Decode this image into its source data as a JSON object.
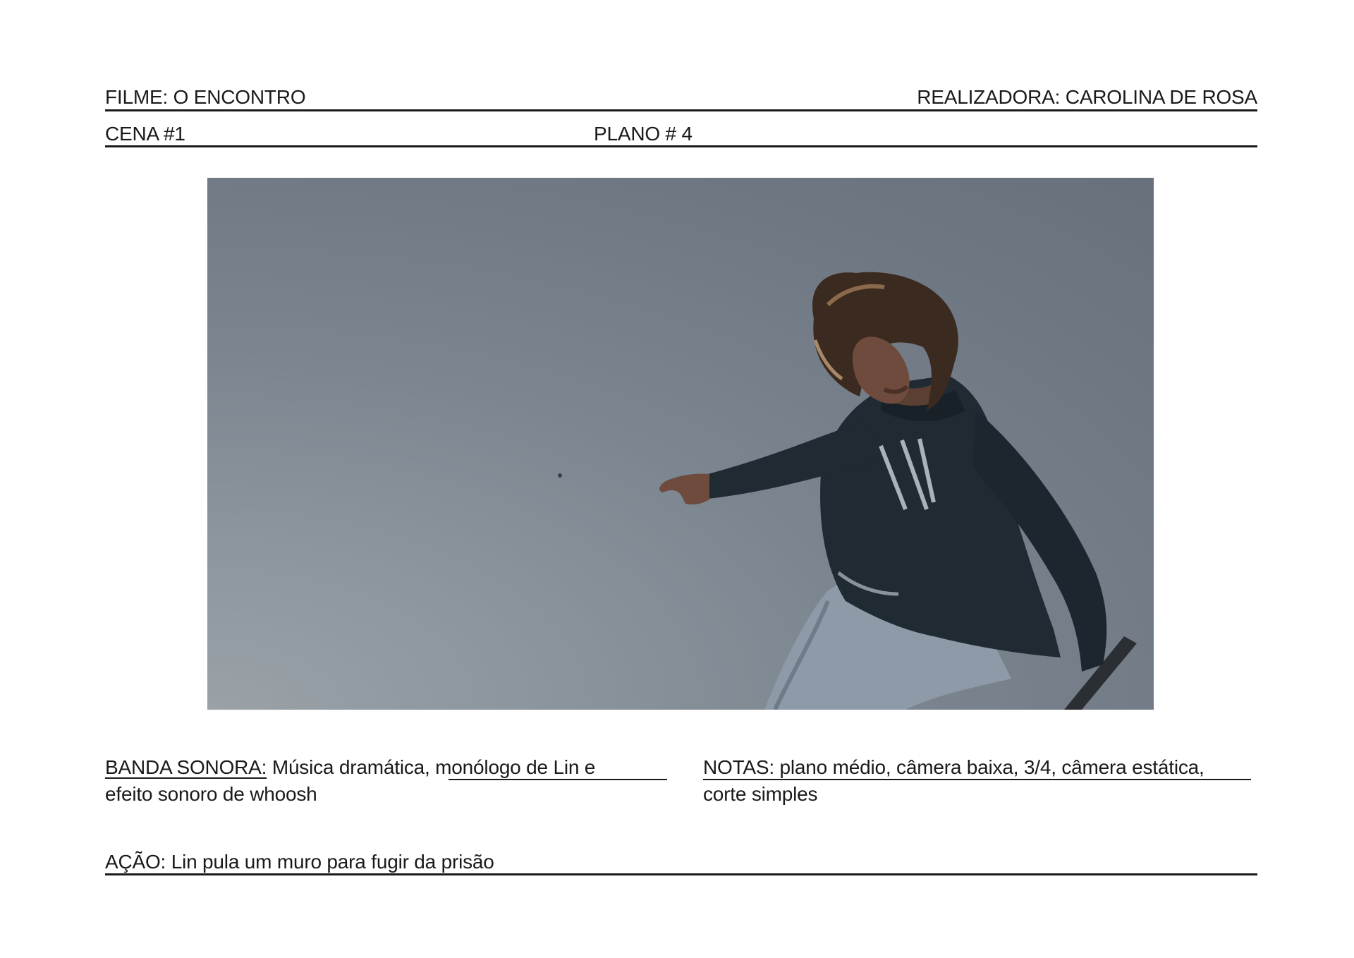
{
  "header": {
    "film_title": "FILME: O ENCONTRO",
    "director": "REALIZADORA: CAROLINA DE ROSA",
    "scene": "CENA #1",
    "shot": "PLANO # 4"
  },
  "frame": {
    "subject": "person-jumping-wall",
    "colors": {
      "sky_dark": "#656d79",
      "sky_light": "#9aa2a7",
      "jacket": "#1f2a33",
      "jeans": "#8e9aa8",
      "hair": "#3b2a1f",
      "skin": "#6e4b3c"
    }
  },
  "soundtrack": {
    "label": "BANDA SONORA:",
    "line1_rest": " Música dramática, monólogo de Lin e",
    "line2": "efeito sonoro de whoosh"
  },
  "notes": {
    "line1": "NOTAS: plano médio, câmera baixa, 3/4, câmera estática,",
    "line2": "corte simples"
  },
  "action": {
    "text": "AÇÃO: Lin pula um muro para fugir da prisão"
  }
}
